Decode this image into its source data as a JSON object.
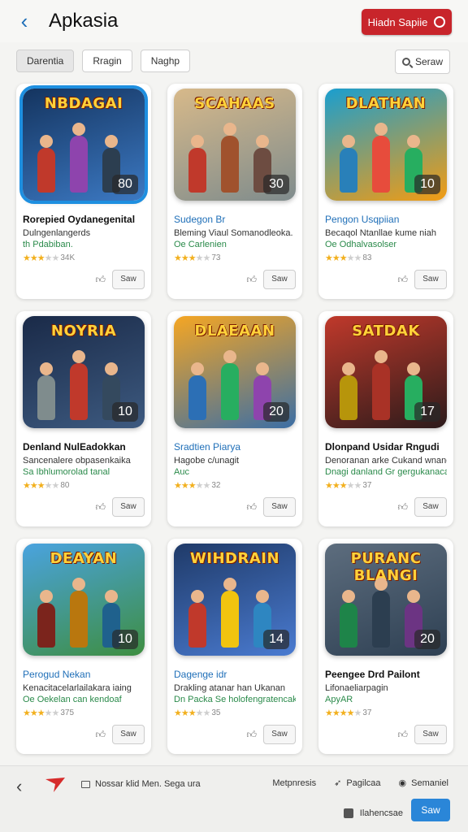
{
  "header": {
    "back_icon": "chevron-left-icon",
    "title": "Apkasia",
    "primary_button": {
      "label": "Hiadn Sapiie",
      "icon": "search-icon",
      "color": "#c8252b"
    }
  },
  "filters": {
    "chips": [
      "Darentia",
      "Rragin",
      "Naghp"
    ],
    "search_label": "Seraw"
  },
  "cards": [
    {
      "art_title": "NBDAGAI",
      "badge": "80",
      "title": "Rorepied Oydanegenital",
      "title_style": "bold",
      "desc": "Dulngenlangerds",
      "sub": "th Pdabiban.",
      "rating_count": "34K",
      "stars": 3,
      "save": "Saw",
      "bg": [
        "#14345f",
        "#3c79c3"
      ],
      "heroes": [
        "#c0392b",
        "#8e44ad",
        "#2c3e50"
      ]
    },
    {
      "art_title": "SCAHAAS",
      "badge": "30",
      "title": "Sudegon Br",
      "title_style": "accent",
      "desc": "Bleming Viaul Somanodleoka.",
      "sub": "Oe Carlenien",
      "rating_count": "73",
      "stars": 3,
      "save": "Saw",
      "bg": [
        "#d7b98a",
        "#7f8c8d"
      ],
      "heroes": [
        "#c0392b",
        "#a0522d",
        "#6d4c41"
      ]
    },
    {
      "art_title": "DLATHAN",
      "badge": "10",
      "title": "Pengon Usqpiian",
      "title_style": "accent",
      "desc": "Becaqol Ntanllae kume niah",
      "sub": "Oe Odhalvasolser",
      "rating_count": "83",
      "stars": 3,
      "save": "Saw",
      "bg": [
        "#1a9ecf",
        "#f39c12"
      ],
      "heroes": [
        "#2980b9",
        "#e74c3c",
        "#27ae60"
      ]
    },
    {
      "art_title": "NOYRIA",
      "badge": "10",
      "title": "Denland NulEadokkan",
      "title_style": "bold",
      "desc": "Sancenalere obpasenkaika",
      "sub": "Sa Ibhlumorolad tanal",
      "rating_count": "80",
      "stars": 3,
      "save": "Saw",
      "bg": [
        "#1a2a48",
        "#3d5a80"
      ],
      "heroes": [
        "#7f8c8d",
        "#c0392b",
        "#34495e"
      ]
    },
    {
      "art_title": "DLAEAAN",
      "badge": "20",
      "title": "Sradtien Piarya",
      "title_style": "accent",
      "desc": "Hagobe c/unagit",
      "sub": "Auc",
      "rating_count": "32",
      "stars": 3,
      "save": "Saw",
      "bg": [
        "#f5a623",
        "#3b6ea5"
      ],
      "heroes": [
        "#2c6fb5",
        "#27ae60",
        "#8e44ad"
      ]
    },
    {
      "art_title": "SATDAK",
      "badge": "17",
      "title": "Dlonpand Usidar Rngudi",
      "title_style": "bold",
      "desc": "Denoranan arke Cukand wnano",
      "sub": "Dnagi danland Gr gergukanacal",
      "rating_count": "37",
      "stars": 3,
      "save": "Saw",
      "bg": [
        "#c0392b",
        "#2c1b1b"
      ],
      "heroes": [
        "#b7950b",
        "#a93226",
        "#27ae60"
      ]
    },
    {
      "art_title": "DEAYAN",
      "badge": "10",
      "title": "Perogud Nekan",
      "title_style": "accent",
      "desc": "Kenacitacelarlailakara iaing",
      "sub": "Oe Oekelan can kendoaf",
      "rating_count": "375",
      "stars": 3,
      "save": "Saw",
      "bg": [
        "#4aa3df",
        "#3e8e41"
      ],
      "heroes": [
        "#7b241c",
        "#b9770e",
        "#1f618d"
      ]
    },
    {
      "art_title": "WIHDRAIN",
      "badge": "14",
      "title": "Dagenge idr",
      "title_style": "accent",
      "desc": "Drakling atanar han Ukanan",
      "sub": "Dn Packa Se holofengratencak",
      "rating_count": "35",
      "stars": 3,
      "save": "Saw",
      "bg": [
        "#1f3a68",
        "#4a7bd1"
      ],
      "heroes": [
        "#c0392b",
        "#f1c40f",
        "#2e86c1"
      ]
    },
    {
      "art_title": "PURANC BLANGI",
      "badge": "20",
      "title": "Peengee Drd Pailont",
      "title_style": "bold",
      "desc": "Lifonaeliarpagin",
      "sub": "ApyAR",
      "rating_count": "37",
      "stars": 4,
      "save": "Saw",
      "bg": [
        "#5d6d7e",
        "#2e4053"
      ],
      "heroes": [
        "#1e8449",
        "#2c3e50",
        "#6c3483"
      ]
    }
  ],
  "footer": {
    "back_icon": "chevron-left-icon",
    "breadcrumb": "Nossar klid Men. Sega ura",
    "nav": [
      {
        "label": "Metpnresis",
        "icon": ""
      },
      {
        "label": "Pagilcaa",
        "icon": "compass-icon"
      },
      {
        "label": "Semaniel",
        "icon": "settings-icon"
      }
    ],
    "status_text": "Ilahencsae",
    "primary_label": "Saw"
  }
}
